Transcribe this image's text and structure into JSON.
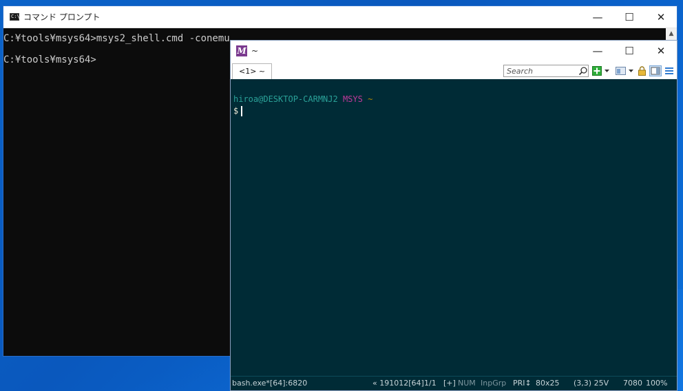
{
  "cmd_window": {
    "title": "コマンド プロンプト",
    "lines": [
      "C:¥tools¥msys64>msys2_shell.cmd -conemu",
      "C:¥tools¥msys64>"
    ],
    "controls": {
      "minimize": "—",
      "maximize": "☐",
      "close": "✕"
    },
    "scroll_up": "▲"
  },
  "conemu_window": {
    "title": "~",
    "icon_letter": "M",
    "controls": {
      "minimize": "—",
      "maximize": "☐",
      "close": "✕"
    },
    "tab_label": "<1> ~",
    "search": {
      "placeholder": "Search",
      "value": ""
    },
    "terminal": {
      "prompt_user": "hiroa@DESKTOP-CARMNJ2",
      "prompt_env": "MSYS",
      "prompt_path": "~",
      "prompt_symbol": "$"
    },
    "status": {
      "process": "bash.exe*[64]:6820",
      "version": "« 191012[64]",
      "console_index": "1/1",
      "plus": "[+]",
      "num": "NUM",
      "inpgrp": "InpGrp",
      "pri": "PRI↕",
      "size": "80x25",
      "cursor_pos": "(3,3) 25V",
      "pid": "7080",
      "zoom": "100%"
    },
    "colors": {
      "user": "#2aa198",
      "env": "#d33682",
      "path": "#b58900",
      "bg": "#002b36"
    }
  }
}
